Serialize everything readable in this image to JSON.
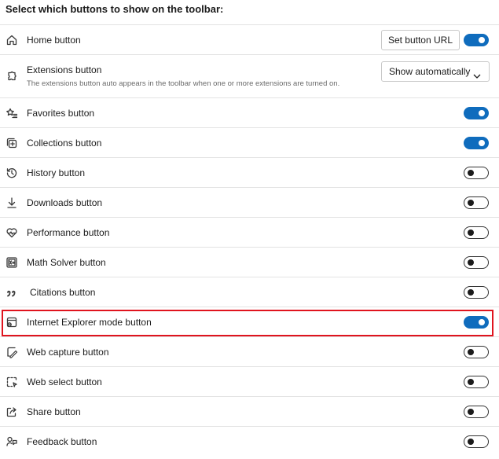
{
  "heading": "Select which buttons to show on the toolbar:",
  "home": {
    "label": "Home button",
    "set_url_label": "Set button URL",
    "icon": "home-icon",
    "on": true
  },
  "extensions": {
    "label": "Extensions button",
    "description": "The extensions button auto appears in the toolbar when one or more extensions are turned on.",
    "select_value": "Show automatically",
    "icon": "puzzle-icon"
  },
  "items": [
    {
      "label": "Favorites button",
      "icon": "favorites-icon",
      "on": true
    },
    {
      "label": "Collections button",
      "icon": "collections-icon",
      "on": true
    },
    {
      "label": "History button",
      "icon": "history-icon",
      "on": false
    },
    {
      "label": "Downloads button",
      "icon": "download-icon",
      "on": false
    },
    {
      "label": "Performance button",
      "icon": "heart-pulse-icon",
      "on": false
    },
    {
      "label": "Math Solver button",
      "icon": "math-solver-icon",
      "on": false
    },
    {
      "label": "Citations button",
      "icon": "quote-icon",
      "on": false
    },
    {
      "label": "Internet Explorer mode button",
      "icon": "ie-mode-icon",
      "on": true
    },
    {
      "label": "Web capture button",
      "icon": "web-capture-icon",
      "on": false
    },
    {
      "label": "Web select button",
      "icon": "web-select-icon",
      "on": false
    },
    {
      "label": "Share button",
      "icon": "share-icon",
      "on": false
    },
    {
      "label": "Feedback button",
      "icon": "feedback-icon",
      "on": false
    }
  ],
  "colors": {
    "accent": "#0f6cbd",
    "highlight": "#e0141e"
  }
}
